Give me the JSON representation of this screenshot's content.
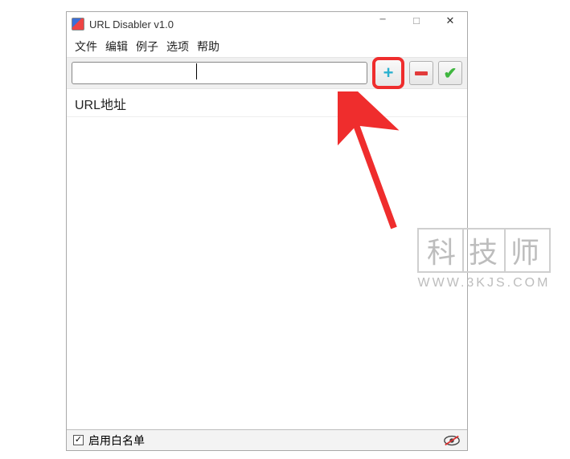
{
  "window": {
    "title": "URL Disabler v1.0"
  },
  "menu": {
    "file": "文件",
    "edit": "编辑",
    "example": "例子",
    "options": "选项",
    "help": "帮助"
  },
  "toolbar": {
    "url_value": "",
    "url_placeholder": "",
    "add_label": "+",
    "remove_label": "-",
    "apply_label": "✔"
  },
  "content": {
    "header": "URL地址"
  },
  "statusbar": {
    "whitelist_label": "启用白名单",
    "whitelist_checked": true
  },
  "watermark": {
    "cn1": "科",
    "cn2": "技",
    "cn3": "师",
    "en": "WWW.3KJS.COM"
  }
}
